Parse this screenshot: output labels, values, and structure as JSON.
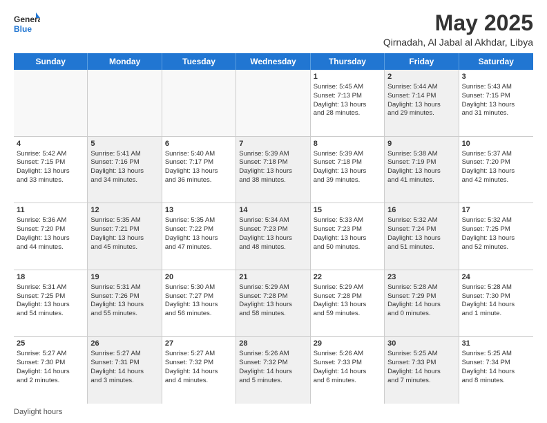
{
  "logo": {
    "general": "General",
    "blue": "Blue"
  },
  "title": "May 2025",
  "subtitle": "Qirnadah, Al Jabal al Akhdar, Libya",
  "days": [
    "Sunday",
    "Monday",
    "Tuesday",
    "Wednesday",
    "Thursday",
    "Friday",
    "Saturday"
  ],
  "footer": "Daylight hours",
  "rows": [
    [
      {
        "day": "",
        "info": "",
        "empty": true
      },
      {
        "day": "",
        "info": "",
        "empty": true
      },
      {
        "day": "",
        "info": "",
        "empty": true
      },
      {
        "day": "",
        "info": "",
        "empty": true
      },
      {
        "day": "1",
        "info": "Sunrise: 5:45 AM\nSunset: 7:13 PM\nDaylight: 13 hours\nand 28 minutes.",
        "empty": false
      },
      {
        "day": "2",
        "info": "Sunrise: 5:44 AM\nSunset: 7:14 PM\nDaylight: 13 hours\nand 29 minutes.",
        "empty": false,
        "shaded": true
      },
      {
        "day": "3",
        "info": "Sunrise: 5:43 AM\nSunset: 7:15 PM\nDaylight: 13 hours\nand 31 minutes.",
        "empty": false
      }
    ],
    [
      {
        "day": "4",
        "info": "Sunrise: 5:42 AM\nSunset: 7:15 PM\nDaylight: 13 hours\nand 33 minutes.",
        "empty": false
      },
      {
        "day": "5",
        "info": "Sunrise: 5:41 AM\nSunset: 7:16 PM\nDaylight: 13 hours\nand 34 minutes.",
        "empty": false,
        "shaded": true
      },
      {
        "day": "6",
        "info": "Sunrise: 5:40 AM\nSunset: 7:17 PM\nDaylight: 13 hours\nand 36 minutes.",
        "empty": false
      },
      {
        "day": "7",
        "info": "Sunrise: 5:39 AM\nSunset: 7:18 PM\nDaylight: 13 hours\nand 38 minutes.",
        "empty": false,
        "shaded": true
      },
      {
        "day": "8",
        "info": "Sunrise: 5:39 AM\nSunset: 7:18 PM\nDaylight: 13 hours\nand 39 minutes.",
        "empty": false
      },
      {
        "day": "9",
        "info": "Sunrise: 5:38 AM\nSunset: 7:19 PM\nDaylight: 13 hours\nand 41 minutes.",
        "empty": false,
        "shaded": true
      },
      {
        "day": "10",
        "info": "Sunrise: 5:37 AM\nSunset: 7:20 PM\nDaylight: 13 hours\nand 42 minutes.",
        "empty": false
      }
    ],
    [
      {
        "day": "11",
        "info": "Sunrise: 5:36 AM\nSunset: 7:20 PM\nDaylight: 13 hours\nand 44 minutes.",
        "empty": false
      },
      {
        "day": "12",
        "info": "Sunrise: 5:35 AM\nSunset: 7:21 PM\nDaylight: 13 hours\nand 45 minutes.",
        "empty": false,
        "shaded": true
      },
      {
        "day": "13",
        "info": "Sunrise: 5:35 AM\nSunset: 7:22 PM\nDaylight: 13 hours\nand 47 minutes.",
        "empty": false
      },
      {
        "day": "14",
        "info": "Sunrise: 5:34 AM\nSunset: 7:23 PM\nDaylight: 13 hours\nand 48 minutes.",
        "empty": false,
        "shaded": true
      },
      {
        "day": "15",
        "info": "Sunrise: 5:33 AM\nSunset: 7:23 PM\nDaylight: 13 hours\nand 50 minutes.",
        "empty": false
      },
      {
        "day": "16",
        "info": "Sunrise: 5:32 AM\nSunset: 7:24 PM\nDaylight: 13 hours\nand 51 minutes.",
        "empty": false,
        "shaded": true
      },
      {
        "day": "17",
        "info": "Sunrise: 5:32 AM\nSunset: 7:25 PM\nDaylight: 13 hours\nand 52 minutes.",
        "empty": false
      }
    ],
    [
      {
        "day": "18",
        "info": "Sunrise: 5:31 AM\nSunset: 7:25 PM\nDaylight: 13 hours\nand 54 minutes.",
        "empty": false
      },
      {
        "day": "19",
        "info": "Sunrise: 5:31 AM\nSunset: 7:26 PM\nDaylight: 13 hours\nand 55 minutes.",
        "empty": false,
        "shaded": true
      },
      {
        "day": "20",
        "info": "Sunrise: 5:30 AM\nSunset: 7:27 PM\nDaylight: 13 hours\nand 56 minutes.",
        "empty": false
      },
      {
        "day": "21",
        "info": "Sunrise: 5:29 AM\nSunset: 7:28 PM\nDaylight: 13 hours\nand 58 minutes.",
        "empty": false,
        "shaded": true
      },
      {
        "day": "22",
        "info": "Sunrise: 5:29 AM\nSunset: 7:28 PM\nDaylight: 13 hours\nand 59 minutes.",
        "empty": false
      },
      {
        "day": "23",
        "info": "Sunrise: 5:28 AM\nSunset: 7:29 PM\nDaylight: 14 hours\nand 0 minutes.",
        "empty": false,
        "shaded": true
      },
      {
        "day": "24",
        "info": "Sunrise: 5:28 AM\nSunset: 7:30 PM\nDaylight: 14 hours\nand 1 minute.",
        "empty": false
      }
    ],
    [
      {
        "day": "25",
        "info": "Sunrise: 5:27 AM\nSunset: 7:30 PM\nDaylight: 14 hours\nand 2 minutes.",
        "empty": false
      },
      {
        "day": "26",
        "info": "Sunrise: 5:27 AM\nSunset: 7:31 PM\nDaylight: 14 hours\nand 3 minutes.",
        "empty": false,
        "shaded": true
      },
      {
        "day": "27",
        "info": "Sunrise: 5:27 AM\nSunset: 7:32 PM\nDaylight: 14 hours\nand 4 minutes.",
        "empty": false
      },
      {
        "day": "28",
        "info": "Sunrise: 5:26 AM\nSunset: 7:32 PM\nDaylight: 14 hours\nand 5 minutes.",
        "empty": false,
        "shaded": true
      },
      {
        "day": "29",
        "info": "Sunrise: 5:26 AM\nSunset: 7:33 PM\nDaylight: 14 hours\nand 6 minutes.",
        "empty": false
      },
      {
        "day": "30",
        "info": "Sunrise: 5:25 AM\nSunset: 7:33 PM\nDaylight: 14 hours\nand 7 minutes.",
        "empty": false,
        "shaded": true
      },
      {
        "day": "31",
        "info": "Sunrise: 5:25 AM\nSunset: 7:34 PM\nDaylight: 14 hours\nand 8 minutes.",
        "empty": false
      }
    ]
  ]
}
